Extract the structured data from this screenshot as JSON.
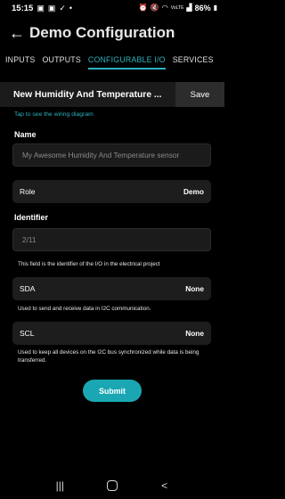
{
  "status_bar": {
    "time": "15:15",
    "left_icons": [
      "photo-icon",
      "photo-icon",
      "check-icon",
      "dot-icon"
    ],
    "right_text": "VoLTE",
    "battery_pct": "86%"
  },
  "header": {
    "title": "Demo Configuration"
  },
  "tabs": [
    {
      "label": "INPUTS",
      "active": false
    },
    {
      "label": "OUTPUTS",
      "active": false
    },
    {
      "label": "CONFIGURABLE I/O",
      "active": true
    },
    {
      "label": "SERVICES",
      "active": false
    }
  ],
  "device": {
    "name": "New Humidity And Temperature ...",
    "save_label": "Save"
  },
  "wiring_link": "Tap to see the wiring diagram",
  "form": {
    "name_label": "Name",
    "name_placeholder": "My Awesome Humidity And Temperature sensor",
    "role_label": "Role",
    "role_value": "Demo",
    "identifier_label": "Identifier",
    "identifier_placeholder": "2/11",
    "identifier_help": "This field is the identifier of the I/O in the electrical project",
    "sda_label": "SDA",
    "sda_value": "None",
    "sda_help": "Used to send and receive data in I2C communication.",
    "scl_label": "SCL",
    "scl_value": "None",
    "scl_help": "Used to keep all devices on the I2C bus synchronized while data is being transferred.",
    "submit_label": "Submit"
  },
  "colors": {
    "accent": "#2bb3c0",
    "submit": "#1aa7b3",
    "background": "#000000",
    "card": "#1d1d1d"
  }
}
